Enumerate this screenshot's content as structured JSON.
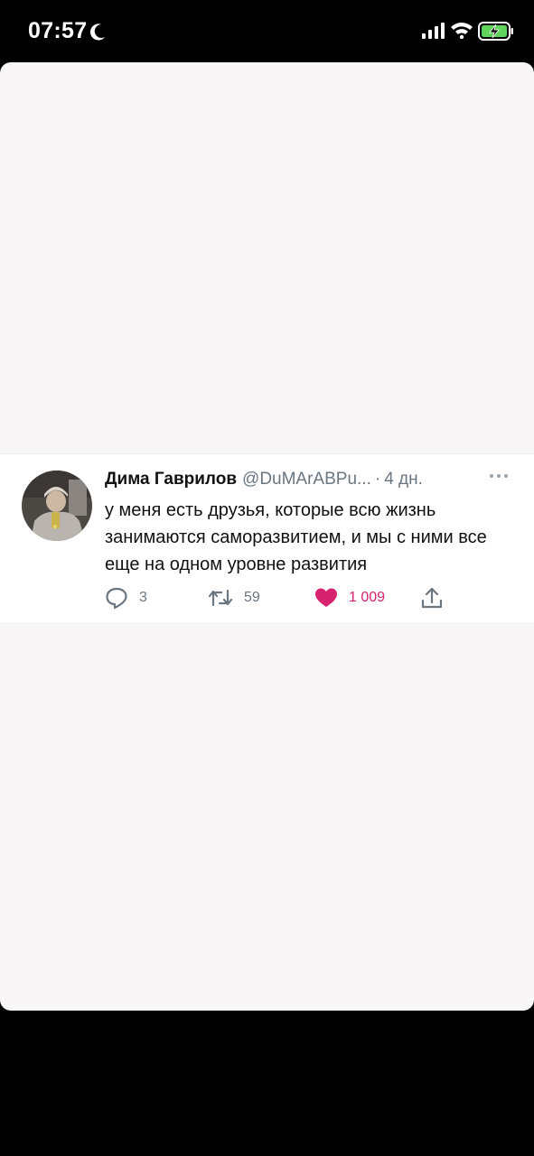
{
  "status_bar": {
    "time": "07:57",
    "icons": [
      "moon-icon",
      "signal-icon",
      "wifi-icon",
      "battery-charging-icon"
    ]
  },
  "tweet": {
    "author_name": "Дима Гаврилов",
    "handle": "@DuMArABPu...",
    "separator": "·",
    "age": "4 дн.",
    "text": "у меня есть друзья, которые всю жизнь занимаются саморазвитием, и мы с ними все еще на одном уровне развития",
    "actions": {
      "replies": "3",
      "retweets": "59",
      "likes": "1 009"
    }
  },
  "colors": {
    "like_accent": "#d6226f",
    "muted_text": "#6b7680",
    "battery_green": "#5fd35a"
  }
}
